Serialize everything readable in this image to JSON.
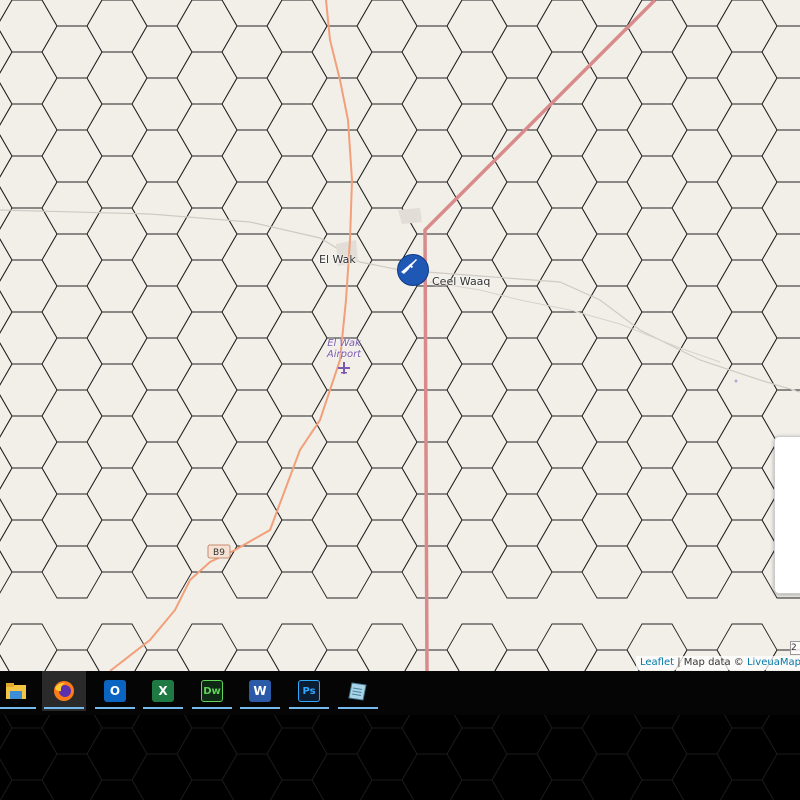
{
  "map": {
    "places": [
      {
        "name": "El Wak"
      },
      {
        "name": "Ceel Waaq"
      }
    ],
    "airport": {
      "line1": "El Wak",
      "line2": "Airport"
    },
    "road_shield": "B9",
    "marker_icon": "rifle-icon",
    "scale_text": "2",
    "attribution": {
      "leaflet": "Leaflet",
      "separator": " | Map data © ",
      "provider": "LiveuaMap ©"
    },
    "colors": {
      "land": "#f2efe9",
      "hex_grid": "#222222",
      "border_line": "#d98a8a",
      "road": "#f2a07a",
      "marker": "#1f57b5"
    }
  },
  "taskbar": {
    "apps": [
      {
        "name": "file-explorer-icon",
        "label": ""
      },
      {
        "name": "firefox-icon",
        "label": ""
      },
      {
        "name": "outlook-icon",
        "label": "O"
      },
      {
        "name": "excel-icon",
        "label": "X"
      },
      {
        "name": "dreamweaver-icon",
        "label": "Dw"
      },
      {
        "name": "word-icon",
        "label": "W"
      },
      {
        "name": "photoshop-icon",
        "label": "Ps"
      },
      {
        "name": "notepad-icon",
        "label": ""
      }
    ]
  }
}
